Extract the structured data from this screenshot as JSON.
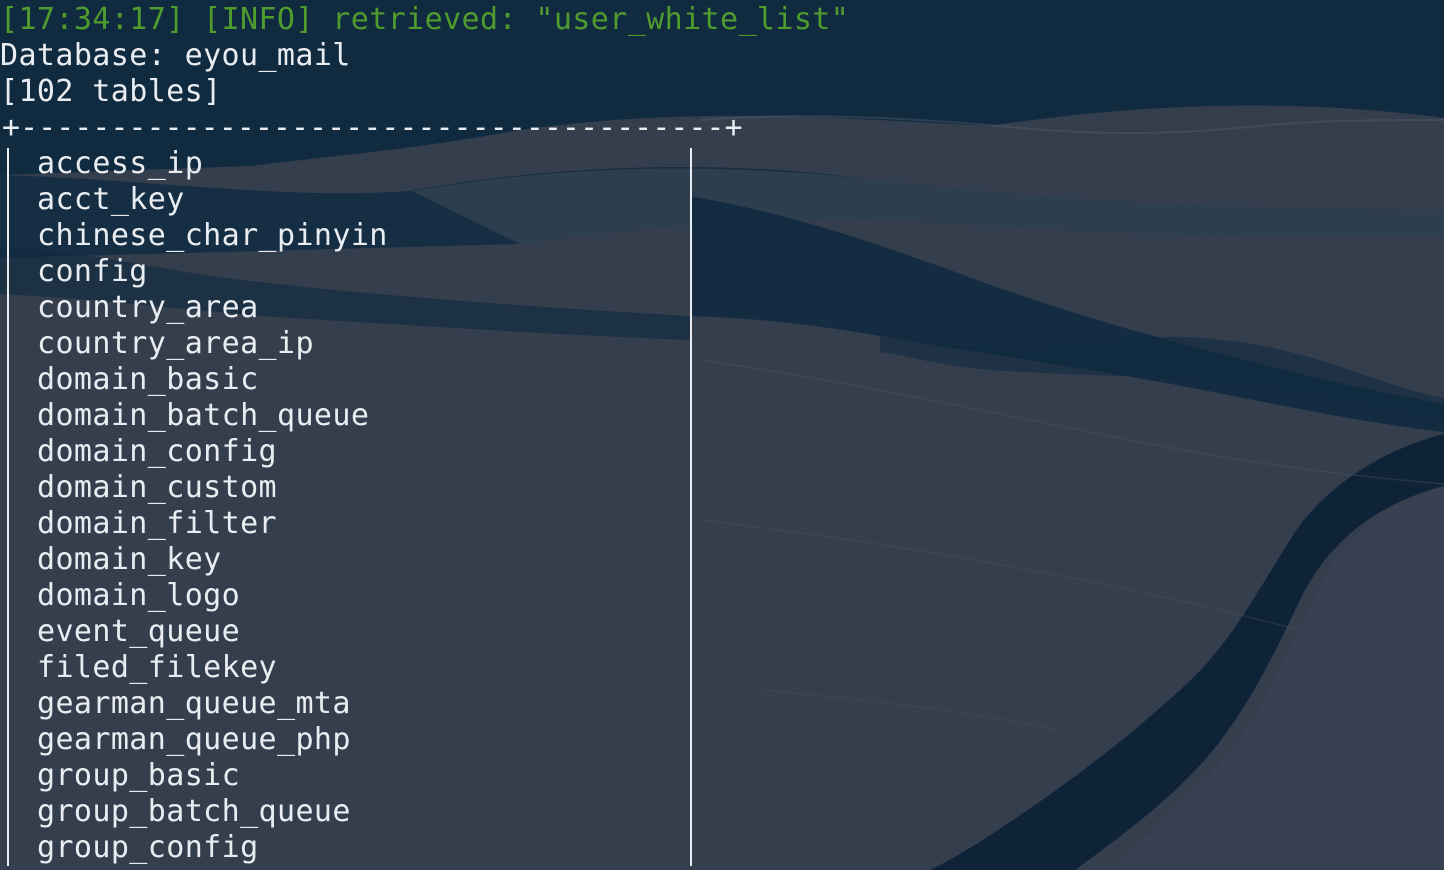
{
  "log": {
    "line": "[17:34:17] [INFO] retrieved: \"user_white_list\""
  },
  "database_line": "Database: eyou_mail",
  "table_count_line": "[102 tables]",
  "table_border_top": "+---------------------------------------+",
  "tables": [
    "access_ip",
    "acct_key",
    "chinese_char_pinyin",
    "config",
    "country_area",
    "country_area_ip",
    "domain_basic",
    "domain_batch_queue",
    "domain_config",
    "domain_custom",
    "domain_filter",
    "domain_key",
    "domain_logo",
    "event_queue",
    "filed_filekey",
    "gearman_queue_mta",
    "gearman_queue_php",
    "group_basic",
    "group_batch_queue",
    "group_config"
  ],
  "colors": {
    "log_text": "#4f9b2e",
    "terminal_text": "#e9edf1",
    "background": "#2b3442"
  }
}
